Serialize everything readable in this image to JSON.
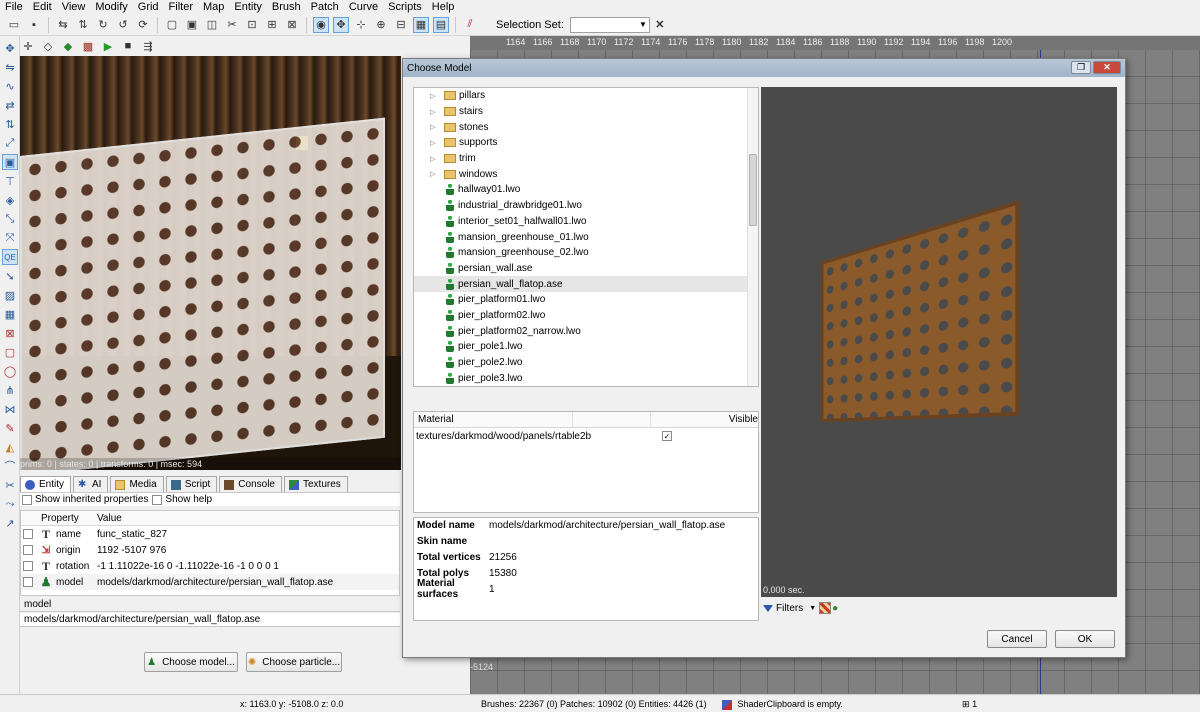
{
  "menubar": [
    "File",
    "Edit",
    "View",
    "Modify",
    "Grid",
    "Filter",
    "Map",
    "Entity",
    "Brush",
    "Patch",
    "Curve",
    "Scripts",
    "Help"
  ],
  "toolbar": {
    "selection_set_label": "Selection Set:",
    "selection_set_value": ""
  },
  "grid": {
    "ruler_ticks": [
      "1164",
      "1166",
      "1168",
      "1170",
      "1172",
      "1174",
      "1176",
      "1178",
      "1180",
      "1182",
      "1184",
      "1186",
      "1188",
      "1190",
      "1192",
      "1194",
      "1196",
      "1198",
      "1200"
    ],
    "bottom_label": "-5124"
  },
  "camera": {
    "status": "prims: 0 | states: 0 | transforms: 0 | msec: 594"
  },
  "entity_inspector": {
    "tabs": [
      "Entity",
      "AI",
      "Media",
      "Script",
      "Console",
      "Textures"
    ],
    "show_inherited": "Show inherited properties",
    "show_help": "Show help",
    "col_property": "Property",
    "col_value": "Value",
    "rows": [
      {
        "key": "name",
        "value": "func_static_827"
      },
      {
        "key": "origin",
        "value": "1192 -5107 976"
      },
      {
        "key": "rotation",
        "value": "-1 1.11022e-16 0 -1.11022e-16 -1 0 0 0 1"
      },
      {
        "key": "model",
        "value": "models/darkmod/architecture/persian_wall_flatop.ase"
      }
    ],
    "key_field": "model",
    "value_field": "models/darkmod/architecture/persian_wall_flatop.ase",
    "choose_model": "Choose model...",
    "choose_particle": "Choose particle..."
  },
  "statusbar": {
    "coords": "x:  1163.0  y:  -5108.0  z:    0.0",
    "counts": "Brushes: 22367 (0) Patches: 10902 (0) Entities: 4426 (1)",
    "shader": "ShaderClipboard is empty.",
    "grid": "1"
  },
  "dialog": {
    "title": "Choose Model",
    "tree": [
      {
        "type": "folder",
        "label": "pillars"
      },
      {
        "type": "folder",
        "label": "stairs"
      },
      {
        "type": "folder",
        "label": "stones"
      },
      {
        "type": "folder",
        "label": "supports"
      },
      {
        "type": "folder",
        "label": "trim"
      },
      {
        "type": "folder",
        "label": "windows"
      },
      {
        "type": "model",
        "label": "hallway01.lwo"
      },
      {
        "type": "model",
        "label": "industrial_drawbridge01.lwo"
      },
      {
        "type": "model",
        "label": "interior_set01_halfwall01.lwo"
      },
      {
        "type": "model",
        "label": "mansion_greenhouse_01.lwo"
      },
      {
        "type": "model",
        "label": "mansion_greenhouse_02.lwo"
      },
      {
        "type": "model",
        "label": "persian_wall.ase"
      },
      {
        "type": "model",
        "label": "persian_wall_flatop.ase",
        "selected": true
      },
      {
        "type": "model",
        "label": "pier_platform01.lwo"
      },
      {
        "type": "model",
        "label": "pier_platform02.lwo"
      },
      {
        "type": "model",
        "label": "pier_platform02_narrow.lwo"
      },
      {
        "type": "model",
        "label": "pier_pole1.lwo"
      },
      {
        "type": "model",
        "label": "pier_pole2.lwo"
      },
      {
        "type": "model",
        "label": "pier_pole3.lwo"
      }
    ],
    "material_header": "Material",
    "visible_header": "Visible",
    "material_row": "textures/darkmod/wood/panels/rtable2b",
    "info": [
      {
        "key": "Model name",
        "value": "models/darkmod/architecture/persian_wall_flatop.ase"
      },
      {
        "key": "Skin name",
        "value": ""
      },
      {
        "key": "Total vertices",
        "value": "21256"
      },
      {
        "key": "Total polys",
        "value": "15380"
      },
      {
        "key": "Material surfaces",
        "value": "1"
      }
    ],
    "preview_time": "0.000 sec.",
    "filters": "Filters",
    "cancel": "Cancel",
    "ok": "OK"
  }
}
